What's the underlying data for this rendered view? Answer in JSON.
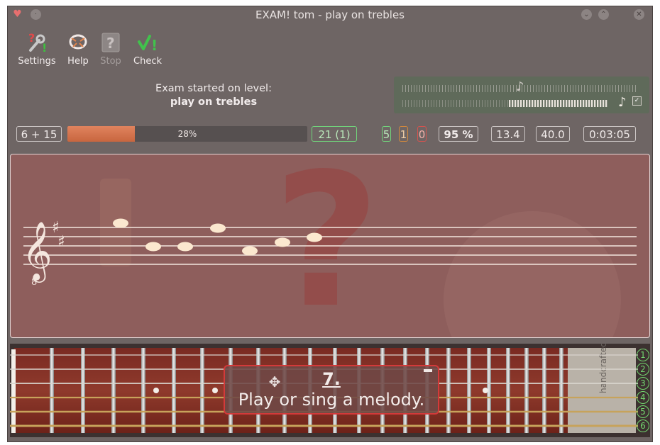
{
  "window": {
    "title": "EXAM! tom - play on trebles"
  },
  "toolbar": {
    "settings_label": "Settings",
    "help_label": "Help",
    "stop_label": "Stop",
    "check_label": "Check"
  },
  "exam_info": {
    "line1": "Exam started on level:",
    "level": "play on trebles"
  },
  "stats": {
    "questions": "6 + 15",
    "progress_percent": 28,
    "progress_text": "28%",
    "remaining": "21 (1)",
    "correct": "5",
    "not_bad": "1",
    "wrong": "0",
    "effectiveness": "95 %",
    "avg_time": "13.4",
    "last_time": "40.0",
    "total_time": "0:03:05"
  },
  "staff": {
    "clef": "treble-8vb",
    "key_signature": "D major (2 sharps)"
  },
  "question": {
    "number": "7.",
    "text": "Play or sing a melody."
  },
  "fretboard": {
    "strings": [
      "1",
      "2",
      "3",
      "4",
      "5",
      "6"
    ],
    "watermark": "handcrafted"
  },
  "colors": {
    "accent": "#d33a3a",
    "progress": "#d9764f",
    "green": "#71d47b"
  }
}
